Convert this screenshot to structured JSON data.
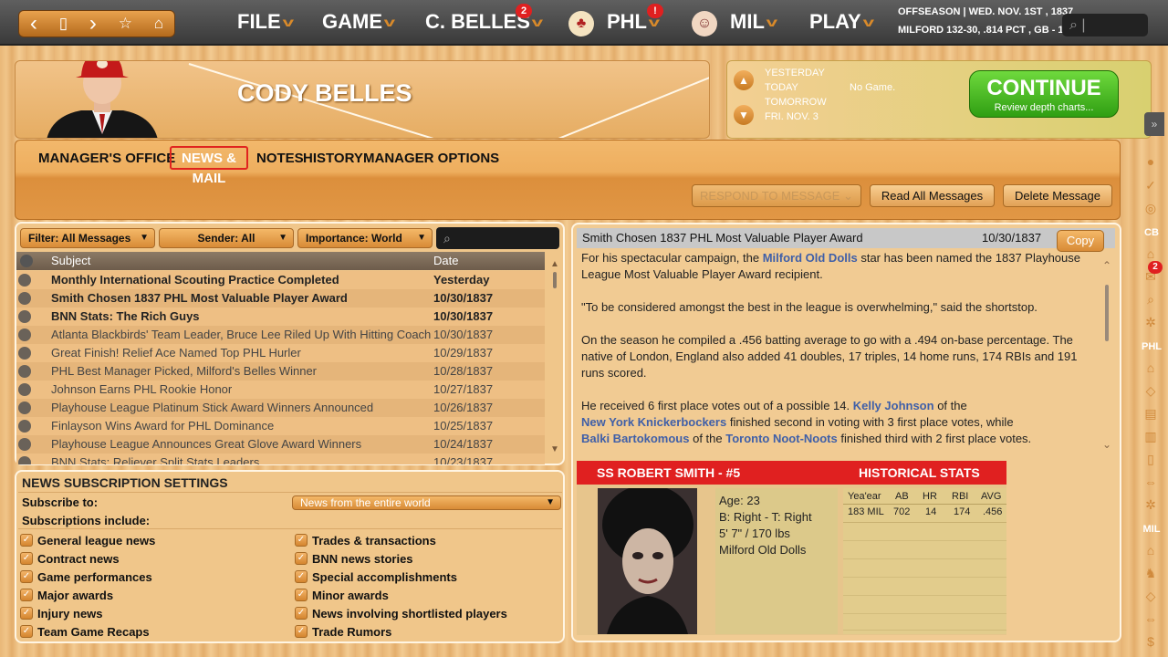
{
  "topbar": {
    "nav_icons": [
      "back-icon",
      "page-icon",
      "forward-icon",
      "star-icon",
      "home-icon"
    ],
    "nav_glyphs": [
      "‹",
      "▯",
      "›",
      "☆",
      "⌂"
    ],
    "menus": [
      {
        "label": "FILE",
        "badge": ""
      },
      {
        "label": "GAME",
        "badge": ""
      },
      {
        "label": "C. BELLES",
        "badge": "2"
      },
      {
        "label": "PHL",
        "badge": "!"
      },
      {
        "label": "MIL",
        "badge": ""
      },
      {
        "label": "PLAY",
        "badge": ""
      }
    ],
    "status_line1": "OFFSEASON  |  WED. NOV. 1ST , 1837",
    "status_line2": "MILFORD   132-30, .814 PCT , GB - 1"
  },
  "header": {
    "manager_name": "CODY BELLES"
  },
  "dates": {
    "items": [
      "YESTERDAY",
      "TODAY",
      "TOMORROW",
      "FRI. NOV. 3"
    ],
    "today_note": "No Game.",
    "continue_label": "CONTINUE",
    "continue_sub": "Review depth charts..."
  },
  "tabs": [
    "MANAGER'S OFFICE",
    "NEWS & MAIL",
    "NOTES",
    "HISTORY",
    "MANAGER OPTIONS"
  ],
  "actions": {
    "respond": "RESPOND TO MESSAGE",
    "read_all": "Read All Messages",
    "delete": "Delete Message"
  },
  "filters": {
    "filter": "Filter: All Messages",
    "sender": "Sender: All",
    "importance": "Importance: World"
  },
  "list": {
    "col_subject": "Subject",
    "col_date": "Date",
    "rows": [
      {
        "subject": "Monthly International Scouting Practice Completed",
        "date": "Yesterday",
        "unread": true
      },
      {
        "subject": "Smith Chosen 1837 PHL Most Valuable Player Award",
        "date": "10/30/1837",
        "unread": true
      },
      {
        "subject": "BNN Stats: The Rich Guys",
        "date": "10/30/1837",
        "unread": true
      },
      {
        "subject": "Atlanta Blackbirds' Team Leader, Bruce Lee Riled Up With Hitting Coach",
        "date": "10/30/1837",
        "unread": false
      },
      {
        "subject": "Great Finish! Relief Ace Named Top PHL Hurler",
        "date": "10/29/1837",
        "unread": false
      },
      {
        "subject": "PHL Best Manager Picked, Milford's Belles Winner",
        "date": "10/28/1837",
        "unread": false
      },
      {
        "subject": "Johnson Earns PHL Rookie Honor",
        "date": "10/27/1837",
        "unread": false
      },
      {
        "subject": "Playhouse League Platinum Stick Award Winners Announced",
        "date": "10/26/1837",
        "unread": false
      },
      {
        "subject": "Finlayson Wins Award for PHL Dominance",
        "date": "10/25/1837",
        "unread": false
      },
      {
        "subject": "Playhouse League Announces Great Glove Award Winners",
        "date": "10/24/1837",
        "unread": false
      },
      {
        "subject": "BNN Stats: Reliever Split Stats Leaders",
        "date": "10/23/1837",
        "unread": false
      }
    ]
  },
  "subscription": {
    "title": "NEWS SUBSCRIPTION SETTINGS",
    "subscribe_label": "Subscribe to:",
    "subscribe_value": "News from the entire world",
    "include_label": "Subscriptions include:",
    "left": [
      "General league news",
      "Contract news",
      "Game performances",
      "Major awards",
      "Injury news",
      "Team Game Recaps"
    ],
    "right": [
      "Trades & transactions",
      "BNN news stories",
      "Special accomplishments",
      "Minor awards",
      "News involving shortlisted players",
      "Trade Rumors"
    ]
  },
  "message": {
    "subject": "Smith Chosen 1837 PHL Most Valuable Player Award",
    "date": "10/30/1837",
    "copy": "Copy",
    "p1a": "For his spectacular campaign, the ",
    "p1link": "Milford Old Dolls",
    "p1b": " star has been named the 1837 Playhouse League Most Valuable Player Award recipient.",
    "p2": "\"To be considered amongst the best in the league is overwhelming,\" said the shortstop.",
    "p3": "On the season he compiled a .456 batting average to go with a .494 on-base percentage. The native of London, England also added 41 doubles, 17 triples, 14 home runs, 174 RBIs and 191 runs scored.",
    "p4a": "He received 6 first place votes out of a possible 14. ",
    "p4link1": "Kelly Johnson",
    "p4b": " of the",
    "p4link2": "New York Knickerbockers",
    "p4c": " finished second in voting with 3 first place votes, while",
    "p4link3": "Balki Bartokomous",
    "p4d": " of the ",
    "p4link4": "Toronto Noot-Noots",
    "p4e": " finished third with 2 first place votes."
  },
  "player": {
    "title": "SS ROBERT SMITH - #5",
    "stats_title": "HISTORICAL STATS",
    "age": "Age: 23",
    "bt": "B: Right - T: Right",
    "size": "5' 7\" / 170 lbs",
    "team": "Milford Old Dolls",
    "stat_headers": [
      "Yea'ear",
      "AB",
      "HR",
      "RBI",
      "AVG"
    ],
    "stat_row": [
      "183 MIL",
      "702",
      "14",
      "174",
      ".456"
    ]
  },
  "sidebar": {
    "cb": "CB",
    "phl": "PHL",
    "mil": "MIL",
    "mail_badge": "2"
  }
}
